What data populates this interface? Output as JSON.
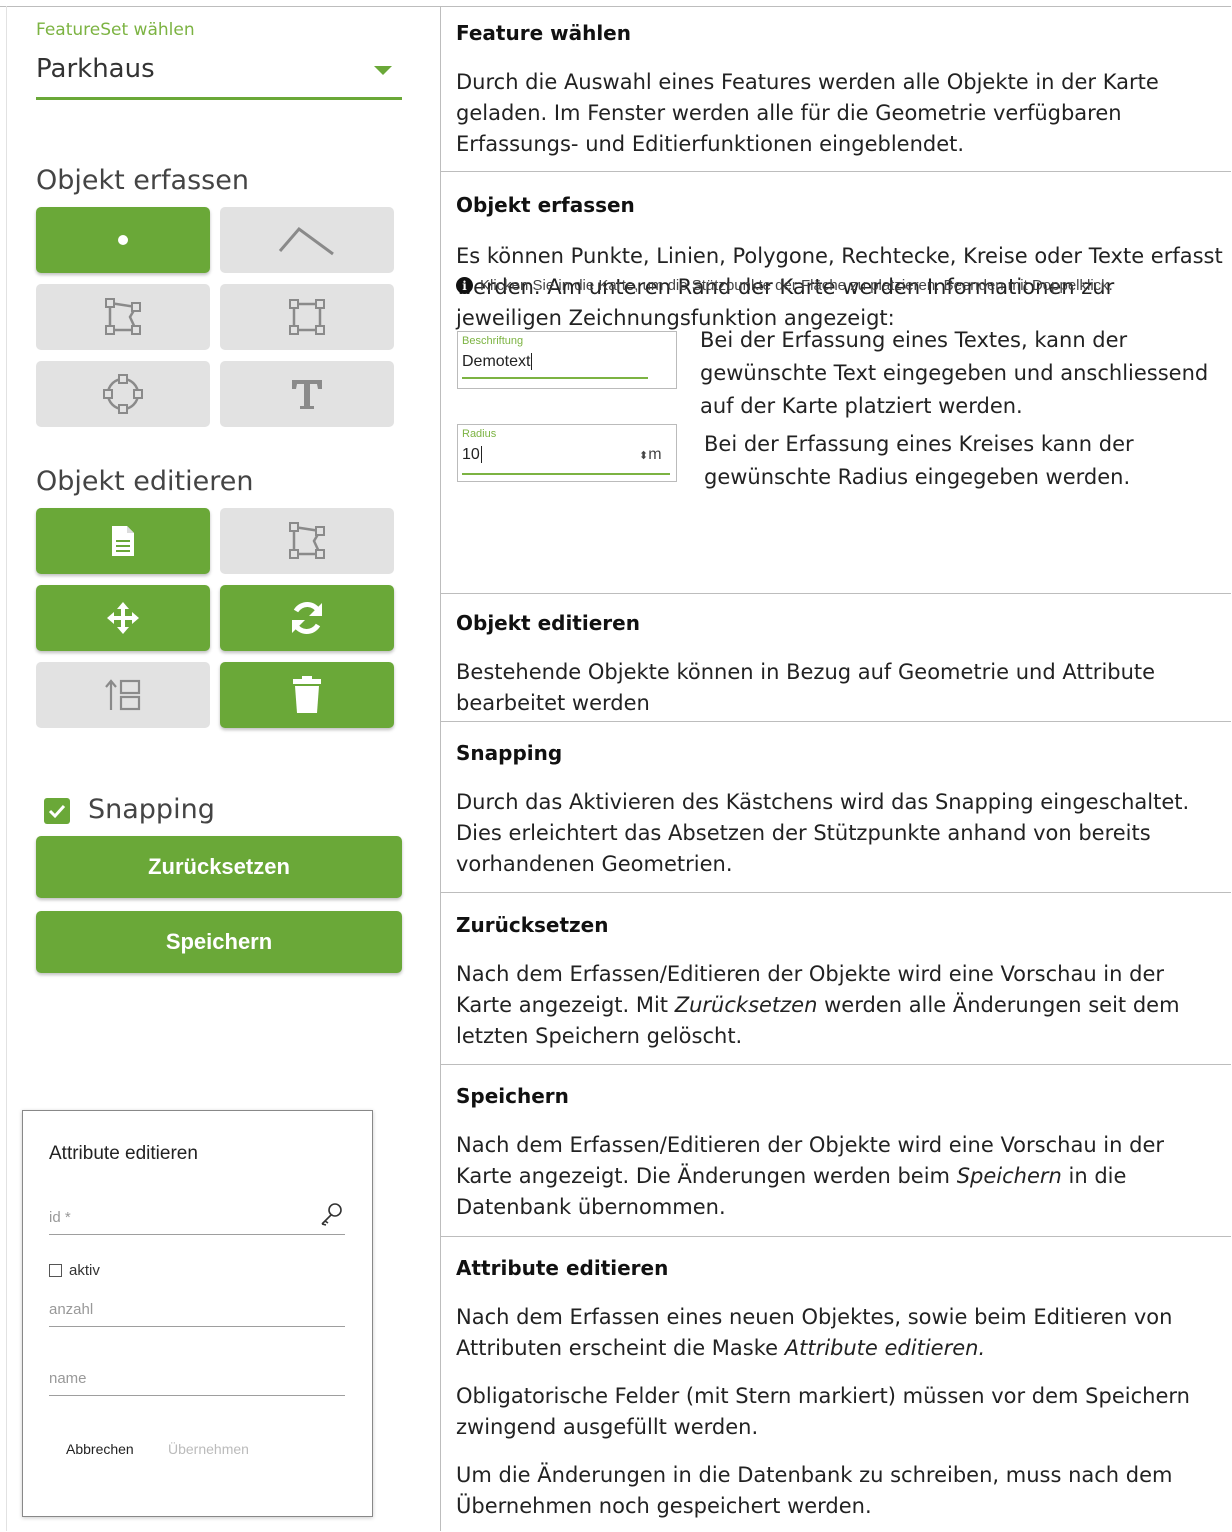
{
  "featureset": {
    "label": "FeatureSet wählen",
    "value": "Parkhaus"
  },
  "capture": {
    "title": "Objekt erfassen",
    "tools": [
      {
        "icon": "point-icon",
        "active": true
      },
      {
        "icon": "line-icon",
        "active": false
      },
      {
        "icon": "polygon-icon",
        "active": false
      },
      {
        "icon": "rectangle-icon",
        "active": false
      },
      {
        "icon": "circle-icon",
        "active": false
      },
      {
        "icon": "text-icon",
        "active": false
      }
    ]
  },
  "edit": {
    "title": "Objekt editieren",
    "tools": [
      {
        "icon": "document-icon",
        "active": true
      },
      {
        "icon": "vertex-edit-icon",
        "active": false
      },
      {
        "icon": "move-icon",
        "active": true
      },
      {
        "icon": "rotate-icon",
        "active": true
      },
      {
        "icon": "order-icon",
        "active": false
      },
      {
        "icon": "trash-icon",
        "active": true
      }
    ]
  },
  "snapping": {
    "label": "Snapping",
    "checked": true
  },
  "buttons": {
    "reset": "Zurücksetzen",
    "save": "Speichern"
  },
  "colors": {
    "accent": "#6aa838",
    "inactive": "#e2e2e2"
  },
  "dialog": {
    "title": "Attribute editieren",
    "id_placeholder": "id *",
    "aktiv_label": "aktiv",
    "anzahl_placeholder": "anzahl",
    "name_placeholder": "name",
    "cancel": "Abbrechen",
    "apply": "Übernehmen"
  },
  "rows": {
    "feature": {
      "heading": "Feature wählen",
      "text": "Durch die Auswahl eines Features werden alle Objekte in der Karte geladen. Im Fenster werden alle für die Geometrie verfügbaren Erfassungs- und Editierfunktionen eingeblendet."
    },
    "capture": {
      "heading": "Objekt erfassen",
      "text": "Es können Punkte, Linien, Polygone, Rechtecke, Kreise oder Texte erfasst werden. Am unteren Rand der Karte werden Informationen zur jeweiligen Zeichnungsfunktion angezeigt:",
      "hint": "Klicken Sie in die Karte, um die Stützpunkte der Fläche zu platzieren. Beenden mit Doppelklick.",
      "text_field": {
        "label": "Beschriftung",
        "value": "Demotext"
      },
      "text_desc": "Bei der Erfassung eines Textes, kann der gewünschte Text eingegeben und anschliessend auf der Karte platziert werden.",
      "radius_field": {
        "label": "Radius",
        "value": "10",
        "unit": "m"
      },
      "radius_desc": "Bei der Erfassung eines Kreises kann der gewünschte Radius eingegeben werden."
    },
    "edit": {
      "heading": "Objekt editieren",
      "text": "Bestehende Objekte können in Bezug auf Geometrie und Attribute bearbeitet werden"
    },
    "snapping": {
      "heading": "Snapping",
      "text": "Durch das Aktivieren des Kästchens wird das Snapping eingeschaltet. Dies erleichtert das Absetzen der Stützpunkte anhand von bereits vorhandenen Geometrien."
    },
    "reset": {
      "heading": "Zurücksetzen",
      "text_pre": "Nach dem Erfassen/Editieren der Objekte wird eine Vorschau in der Karte angezeigt. Mit ",
      "text_em": "Zurücksetzen",
      "text_post": " werden alle Änderungen seit dem letzten Speichern gelöscht."
    },
    "save": {
      "heading": "Speichern",
      "text_pre": "Nach dem Erfassen/Editieren der Objekte wird eine Vorschau in der Karte angezeigt. Die Änderungen werden beim ",
      "text_em": "Speichern",
      "text_post": " in die Datenbank übernommen."
    },
    "attributes": {
      "heading": "Attribute editieren",
      "p1_pre": "Nach dem Erfassen eines neuen Objektes, sowie beim Editieren von Attributen erscheint die Maske ",
      "p1_em": "Attribute editieren.",
      "p2": "Obligatorische Felder (mit Stern markiert) müssen vor dem Speichern zwingend ausgefüllt werden.",
      "p3": "Um die Änderungen in die Datenbank zu schreiben, muss nach dem Übernehmen noch gespeichert werden."
    }
  }
}
